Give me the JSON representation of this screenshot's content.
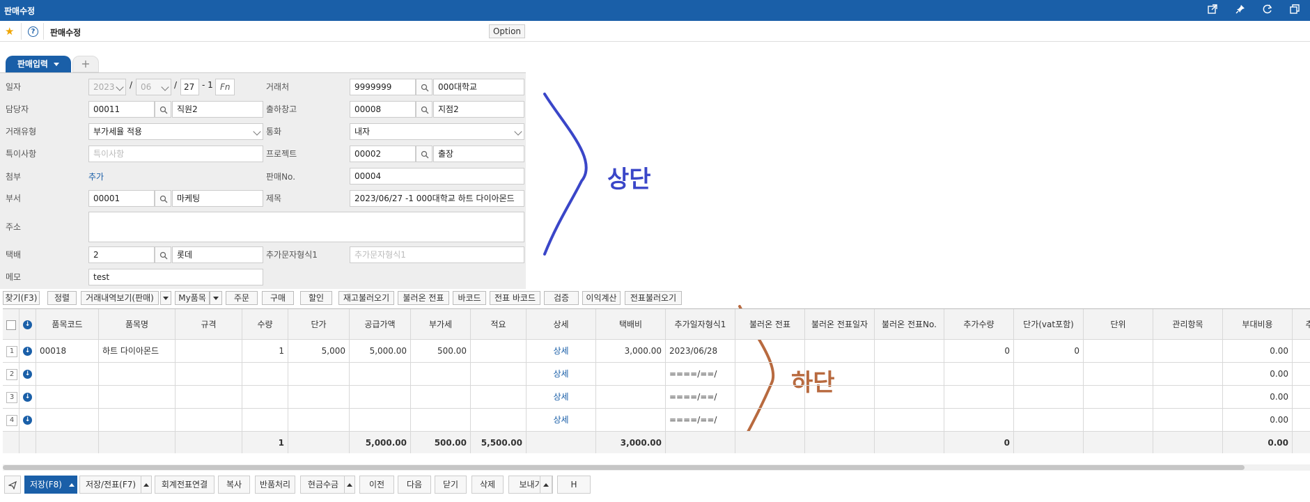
{
  "window": {
    "title": "판매수정"
  },
  "header": {
    "page_title": "판매수정",
    "option_label": "Option",
    "help": "?"
  },
  "tabs": {
    "active_label": "판매입력",
    "add_label": "+"
  },
  "form": {
    "date_label": "일자",
    "date_year": "2023",
    "date_month": "06",
    "date_sep1": "/",
    "date_sep2": "/",
    "date_day": "27",
    "date_seq": "- 1",
    "date_fn": "Fn",
    "client_label": "거래처",
    "client_code": "9999999",
    "client_name": "000대학교",
    "manager_label": "담당자",
    "manager_code": "00011",
    "manager_name": "직원2",
    "warehouse_label": "출하창고",
    "warehouse_code": "00008",
    "warehouse_name": "지점2",
    "trade_type_label": "거래유형",
    "trade_type_value": "부가세율 적용",
    "currency_label": "통화",
    "currency_value": "내자",
    "remarks_label": "특이사항",
    "remarks_placeholder": "특이사항",
    "project_label": "프로젝트",
    "project_code": "00002",
    "project_name": "출장",
    "attach_label": "첨부",
    "attach_link": "추가",
    "sale_no_label": "판매No.",
    "sale_no_value": "00004",
    "dept_label": "부서",
    "dept_code": "00001",
    "dept_name": "마케팅",
    "subject_label": "제목",
    "subject_value": "2023/06/27 -1 000대학교 하트 다이아몬드",
    "address_label": "주소",
    "address_value": "",
    "delivery_label": "택배",
    "delivery_code": "2",
    "delivery_name": "롯데",
    "extra_text_label": "추가문자형식1",
    "extra_text_placeholder": "추가문자형식1",
    "memo_label": "메모",
    "memo_value": "test"
  },
  "annotations": {
    "upper": "상단",
    "lower": "하단",
    "upper_color": "#3a46c8",
    "lower_color": "#b86a3f"
  },
  "actions": [
    "찾기(F3)",
    "정렬",
    "거래내역보기(판매)",
    "My품목",
    "주문",
    "구매",
    "할인",
    "재고불러오기",
    "불러온 전표",
    "바코드",
    "전표 바코드",
    "검증",
    "이익계산",
    "전표불러오기"
  ],
  "grid": {
    "headers": [
      "품목코드",
      "품목명",
      "규격",
      "수량",
      "단가",
      "공급가액",
      "부가세",
      "적요",
      "상세",
      "택배비",
      "추가일자형식1",
      "불러온 전표",
      "불러온 전표일자",
      "불러온 전표No.",
      "추가수량",
      "단가(vat포함)",
      "단위",
      "관리항목",
      "부대비용",
      "추가"
    ],
    "rows": [
      {
        "no": "1",
        "item_code": "00018",
        "item_name": "하트 다이아몬드",
        "spec": "",
        "qty": "1",
        "price": "5,000",
        "supply": "5,000.00",
        "vat": "500.00",
        "summary": "",
        "detail": "상세",
        "delivery_fee": "3,000.00",
        "extra_date": "2023/06/28",
        "loaded_slip": "",
        "loaded_date": "",
        "loaded_no": "",
        "extra_qty": "0",
        "price_vat": "0",
        "unit": "",
        "mgmt": "",
        "extra_cost": "0.00"
      },
      {
        "no": "2",
        "item_code": "",
        "item_name": "",
        "spec": "",
        "qty": "",
        "price": "",
        "supply": "",
        "vat": "",
        "summary": "",
        "detail": "상세",
        "delivery_fee": "",
        "extra_date": "====/==/",
        "loaded_slip": "",
        "loaded_date": "",
        "loaded_no": "",
        "extra_qty": "",
        "price_vat": "",
        "unit": "",
        "mgmt": "",
        "extra_cost": "0.00"
      },
      {
        "no": "3",
        "item_code": "",
        "item_name": "",
        "spec": "",
        "qty": "",
        "price": "",
        "supply": "",
        "vat": "",
        "summary": "",
        "detail": "상세",
        "delivery_fee": "",
        "extra_date": "====/==/",
        "loaded_slip": "",
        "loaded_date": "",
        "loaded_no": "",
        "extra_qty": "",
        "price_vat": "",
        "unit": "",
        "mgmt": "",
        "extra_cost": "0.00"
      },
      {
        "no": "4",
        "item_code": "",
        "item_name": "",
        "spec": "",
        "qty": "",
        "price": "",
        "supply": "",
        "vat": "",
        "summary": "",
        "detail": "상세",
        "delivery_fee": "",
        "extra_date": "====/==/",
        "loaded_slip": "",
        "loaded_date": "",
        "loaded_no": "",
        "extra_qty": "",
        "price_vat": "",
        "unit": "",
        "mgmt": "",
        "extra_cost": "0.00"
      }
    ],
    "totals": {
      "qty": "1",
      "supply": "5,000.00",
      "vat": "500.00",
      "summary": "5,500.00",
      "delivery_fee": "3,000.00",
      "extra_qty": "0",
      "extra_cost": "0.00"
    }
  },
  "bottom": [
    "저장(F8)",
    "저장/전표(F7)",
    "회계전표연결",
    "복사",
    "반품처리",
    "현금수금",
    "이전",
    "다음",
    "닫기",
    "삭제",
    "보내기",
    "H"
  ]
}
